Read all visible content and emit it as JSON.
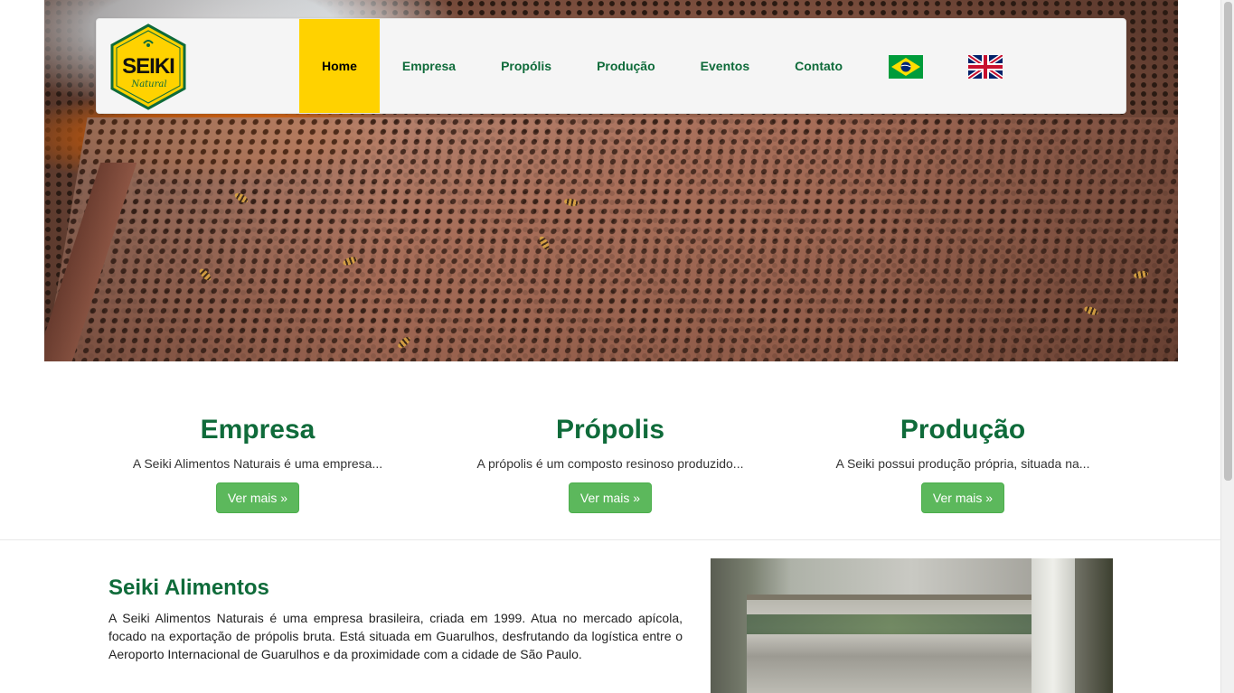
{
  "nav": {
    "items": [
      {
        "label": "Home",
        "active": true
      },
      {
        "label": "Empresa",
        "active": false
      },
      {
        "label": "Propólis",
        "active": false
      },
      {
        "label": "Produção",
        "active": false
      },
      {
        "label": "Eventos",
        "active": false
      },
      {
        "label": "Contato",
        "active": false
      }
    ],
    "languages": [
      "brazil-flag-icon",
      "uk-flag-icon"
    ]
  },
  "logo": {
    "text": "SEIKI",
    "subtext": "Natural"
  },
  "features": [
    {
      "title": "Empresa",
      "text": "A Seiki Alimentos Naturais é uma empresa...",
      "button": "Ver mais »"
    },
    {
      "title": "Própolis",
      "text": "A própolis é um composto resinoso produzido...",
      "button": "Ver mais »"
    },
    {
      "title": "Produção",
      "text": "A Seiki possui produção própria, situada na...",
      "button": "Ver mais »"
    }
  ],
  "about": {
    "title": "Seiki Alimentos",
    "text": "A Seiki Alimentos Naturais é uma empresa brasileira, criada em 1999. Atua no mercado apícola, focado na exportação de própolis bruta. Está situada em Guarulhos, desfrutando da logística entre o Aeroporto Internacional de Guarulhos e da proximidade com a cidade de São Paulo."
  },
  "colors": {
    "brand_green": "#0f6b3a",
    "accent_yellow": "#ffd200",
    "button_green": "#5cb85c"
  }
}
